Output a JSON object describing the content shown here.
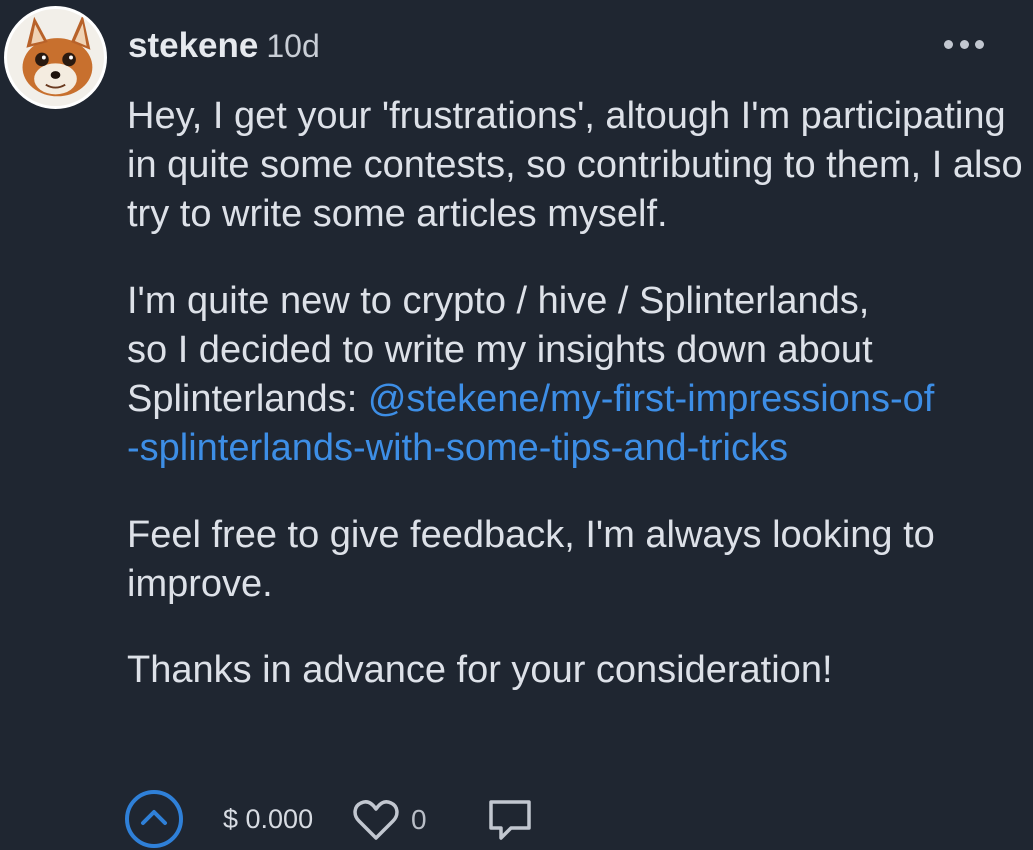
{
  "comment": {
    "author": "stekene",
    "age": "10d",
    "paragraphs": {
      "p1": "Hey, I get your 'frustrations', altough I'm participating in quite some contests, so contributing to them, I also try to write some articles myself.",
      "p2_line1": "I'm quite new to crypto / hive / Splinterlands,",
      "p2_line2": "so I decided to write my insights down about",
      "p2_prefix": "Splinterlands: ",
      "p2_link_line1": "@stekene/my-first-impressions-of",
      "p2_link_line2": "-splinterlands-with-some-tips-and-tricks",
      "p3": "Feel free to give feedback, I'm always looking to improve.",
      "p4": "Thanks in advance for your consideration!"
    }
  },
  "actions": {
    "payout": "$ 0.000",
    "likes": "0"
  },
  "colors": {
    "background": "#1f2631",
    "link": "#3d8ee6",
    "upvote": "#2f80d8",
    "text": "#dde1e8"
  },
  "icons": {
    "avatar": "fox-avatar",
    "menu": "more-dots-icon",
    "upvote": "chevron-up-icon",
    "like": "heart-icon",
    "reply": "comment-icon"
  }
}
